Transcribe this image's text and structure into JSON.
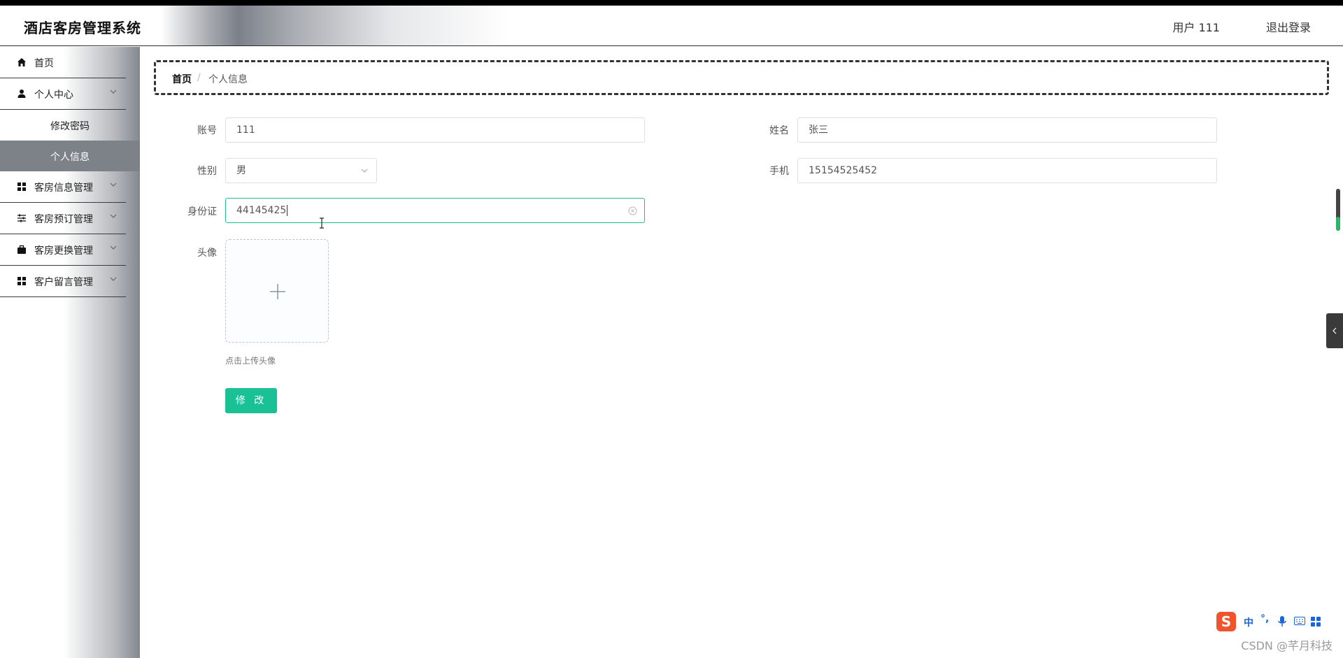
{
  "header": {
    "app_title": "酒店客房管理系统",
    "user_label": "用户 111",
    "logout_label": "退出登录"
  },
  "sidebar": {
    "items": [
      {
        "label": "首页",
        "icon": "home-icon"
      },
      {
        "label": "个人中心",
        "icon": "user-icon",
        "expanded": true,
        "children": [
          {
            "label": "修改密码",
            "active": false
          },
          {
            "label": "个人信息",
            "active": true
          }
        ]
      },
      {
        "label": "客房信息管理",
        "icon": "grid-icon"
      },
      {
        "label": "客房预订管理",
        "icon": "sliders-icon"
      },
      {
        "label": "客房更换管理",
        "icon": "briefcase-icon"
      },
      {
        "label": "客户留言管理",
        "icon": "grid-icon"
      }
    ]
  },
  "breadcrumb": {
    "home": "首页",
    "separator": "/",
    "current": "个人信息"
  },
  "form": {
    "account": {
      "label": "账号",
      "value": "111"
    },
    "name": {
      "label": "姓名",
      "value": "张三"
    },
    "gender": {
      "label": "性别",
      "value": "男"
    },
    "phone": {
      "label": "手机",
      "value": "15154525452"
    },
    "id_card": {
      "label": "身份证",
      "value": "44145425"
    },
    "avatar": {
      "label": "头像",
      "hint": "点击上传头像"
    },
    "submit_label": "修 改"
  },
  "ime": {
    "mode": "中",
    "punct": "°,"
  },
  "watermark": "CSDN @芊月科技",
  "colors": {
    "accent": "#19c195",
    "active_menu_bg": "#7d8188",
    "focus_border": "#1ec08e"
  }
}
